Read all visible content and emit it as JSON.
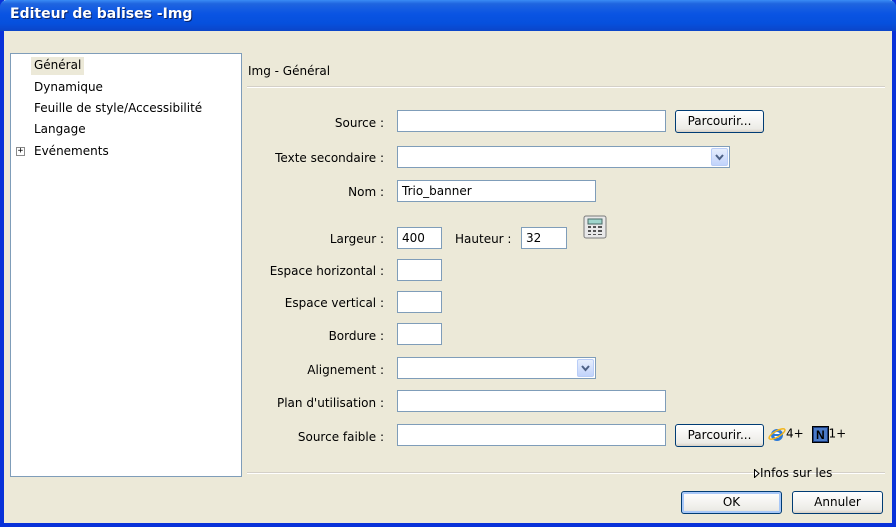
{
  "window": {
    "title": "Editeur de balises -Img"
  },
  "tree": {
    "items": [
      {
        "label": "Général",
        "selected": true
      },
      {
        "label": "Dynamique"
      },
      {
        "label": "Feuille de style/Accessibilité"
      },
      {
        "label": "Langage"
      },
      {
        "label": "Evénements",
        "expander": "+"
      }
    ]
  },
  "panel": {
    "title": "Img - Général"
  },
  "fields": {
    "source": {
      "label": "Source :",
      "value": ""
    },
    "texte_secondaire": {
      "label": "Texte secondaire :",
      "value": ""
    },
    "nom": {
      "label": "Nom :",
      "value": "Trio_banner"
    },
    "largeur": {
      "label": "Largeur :",
      "value": "400"
    },
    "hauteur": {
      "label": "Hauteur :",
      "value": "32"
    },
    "espace_horizontal": {
      "label": "Espace horizontal :",
      "value": ""
    },
    "espace_vertical": {
      "label": "Espace vertical :",
      "value": ""
    },
    "bordure": {
      "label": "Bordure :",
      "value": ""
    },
    "alignement": {
      "label": "Alignement :",
      "value": ""
    },
    "plan_utilisation": {
      "label": "Plan d'utilisation :",
      "value": ""
    },
    "source_faible": {
      "label": "Source faible :",
      "value": ""
    }
  },
  "buttons": {
    "parcourir": "Parcourir...",
    "parcourir2": "Parcourir...",
    "ok": "OK",
    "annuler": "Annuler"
  },
  "browser_support": {
    "ie": "4+",
    "netscape": "1+"
  },
  "infos": {
    "label": "Infos sur les"
  },
  "colors": {
    "titlebar": "#0A54E3",
    "dialog_bg": "#ECE9D8",
    "border": "#7F9DB9"
  }
}
